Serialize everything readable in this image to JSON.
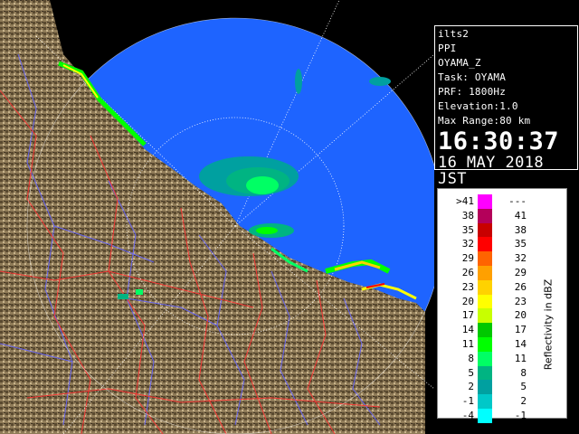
{
  "info": {
    "lines": [
      "ilts2",
      "PPI",
      "OYAMA_Z",
      "Task: OYAMA",
      "PRF: 1800Hz",
      "Elevation:1.0",
      "Max Range:80 km"
    ],
    "time": "16:30:37",
    "date": "16 MAY 2018 JST"
  },
  "legend": {
    "title": "Reflectivity in dBZ",
    "rows": [
      {
        "lo": ">41",
        "hi": "---",
        "color": "#ff00ff"
      },
      {
        "lo": "38",
        "hi": "41",
        "color": "#b4005a"
      },
      {
        "lo": "35",
        "hi": "38",
        "color": "#c80000"
      },
      {
        "lo": "32",
        "hi": "35",
        "color": "#ff0000"
      },
      {
        "lo": "29",
        "hi": "32",
        "color": "#ff6400"
      },
      {
        "lo": "26",
        "hi": "29",
        "color": "#ffa000"
      },
      {
        "lo": "23",
        "hi": "26",
        "color": "#ffd200"
      },
      {
        "lo": "20",
        "hi": "23",
        "color": "#ffff00"
      },
      {
        "lo": "17",
        "hi": "20",
        "color": "#c8ff00"
      },
      {
        "lo": "14",
        "hi": "17",
        "color": "#00c800"
      },
      {
        "lo": "11",
        "hi": "14",
        "color": "#00ff00"
      },
      {
        "lo": "8",
        "hi": "11",
        "color": "#00ff64"
      },
      {
        "lo": "5",
        "hi": "8",
        "color": "#00b482"
      },
      {
        "lo": "2",
        "hi": "5",
        "color": "#00a0a0"
      },
      {
        "lo": "-1",
        "hi": "2",
        "color": "#00c8c8"
      },
      {
        "lo": "-4",
        "hi": "-1",
        "color": "#00ffff"
      }
    ]
  },
  "colors": {
    "sea": "#1e64ff",
    "land": "#8c7a5a",
    "range_ring": "#ffffff",
    "rivers": "#6464ff",
    "boundaries": "#ff3232"
  }
}
